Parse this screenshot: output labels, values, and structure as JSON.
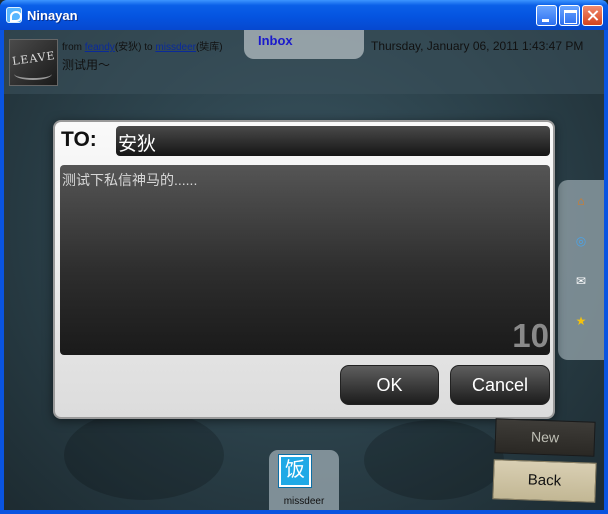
{
  "window": {
    "title": "Ninayan"
  },
  "message": {
    "from_prefix": "from ",
    "sender_link": "feandy",
    "sender_alias": "(安狄)",
    "to_word": " to ",
    "recipient_link": "missdeer",
    "recipient_alias": "(奘库)",
    "text": "测试用～",
    "timestamp": "Thursday, January 06, 2011 1:43:47 PM"
  },
  "tabs": {
    "inbox_label": "Inbox"
  },
  "side_panel": {
    "icons": [
      "home-icon",
      "globe-icon",
      "mail-icon",
      "star-icon"
    ]
  },
  "dialog": {
    "to_label": "TO:",
    "to_value": "安狄",
    "body_text": "测试下私信神马的......",
    "char_count": "10",
    "ok_label": "OK",
    "cancel_label": "Cancel"
  },
  "buttons": {
    "new_label": "New",
    "back_label": "Back"
  },
  "user_tab": {
    "icon_glyph": "饭",
    "label": "missdeer"
  },
  "colors": {
    "titlebar": "#0554e0",
    "link": "#0a2a9a",
    "inbox_text": "#1a1acc"
  }
}
